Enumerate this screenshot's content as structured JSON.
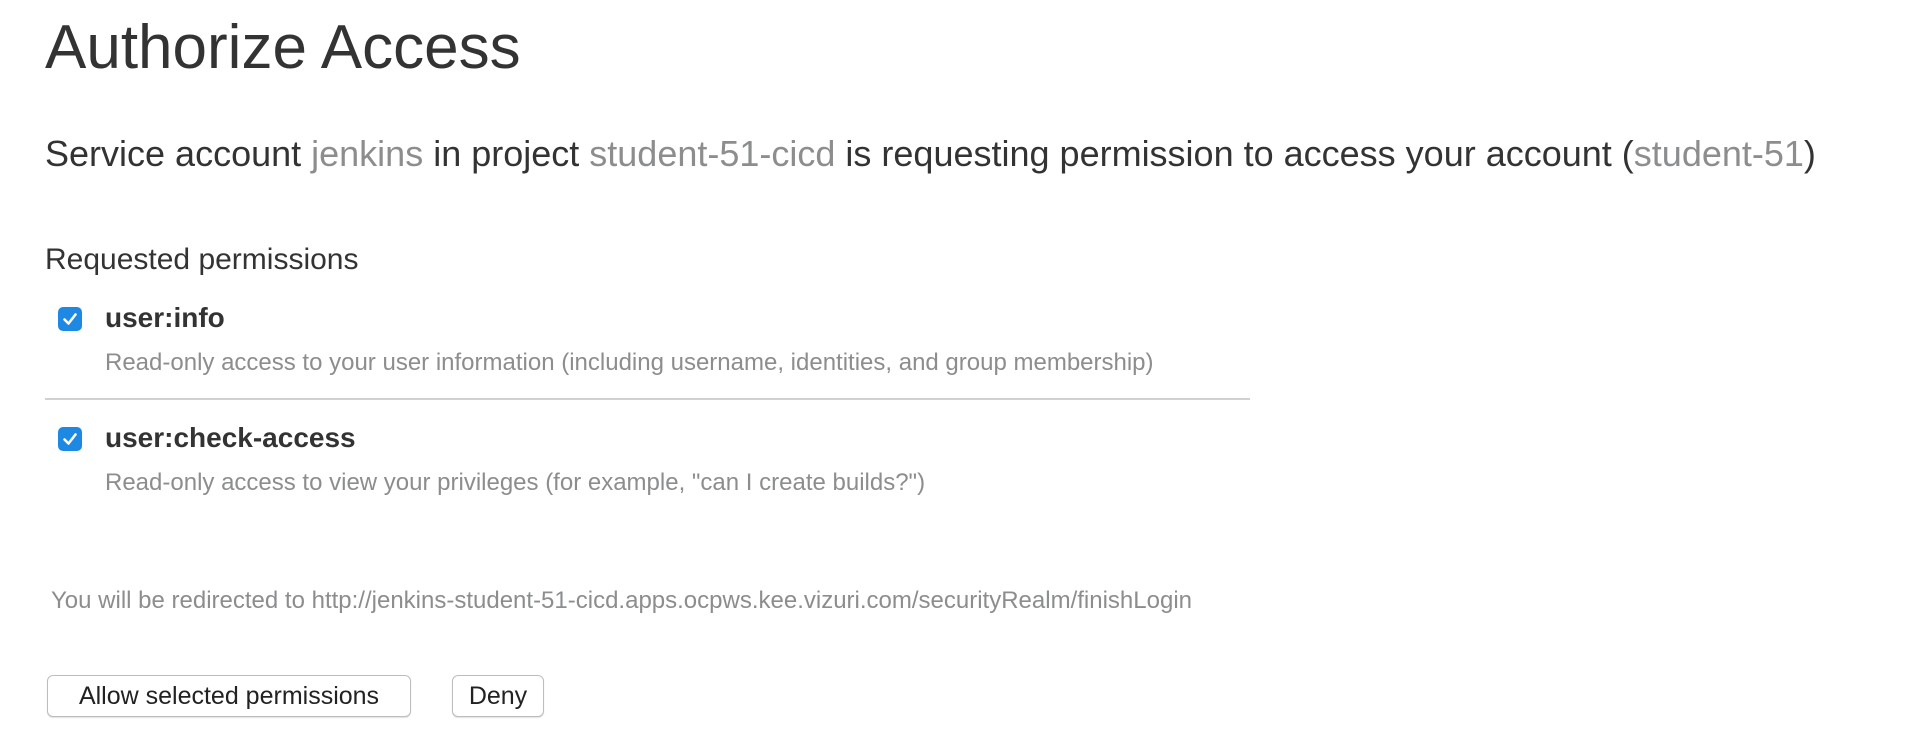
{
  "page": {
    "title": "Authorize Access"
  },
  "request": {
    "prefix": "Service account ",
    "account": "jenkins",
    "middle1": " in project ",
    "project": "student-51-cicd",
    "middle2": " is requesting permission to access your account (",
    "user": "student-51",
    "suffix": ")"
  },
  "permissions": {
    "heading": "Requested permissions",
    "items": [
      {
        "name": "user:info",
        "description": "Read-only access to your user information (including username, identities, and group membership)",
        "checked": true
      },
      {
        "name": "user:check-access",
        "description": "Read-only access to view your privileges (for example, \"can I create builds?\")",
        "checked": true
      }
    ]
  },
  "redirect": {
    "text": "You will be redirected to http://jenkins-student-51-cicd.apps.ocpws.kee.vizuri.com/securityRealm/finishLogin"
  },
  "actions": {
    "allow_label": "Allow selected permissions",
    "deny_label": "Deny"
  },
  "colors": {
    "accent": "#1e88e5",
    "muted_text": "#8b8d8f",
    "text": "#333333"
  },
  "icons": {
    "checkbox": "checkmark-icon"
  }
}
